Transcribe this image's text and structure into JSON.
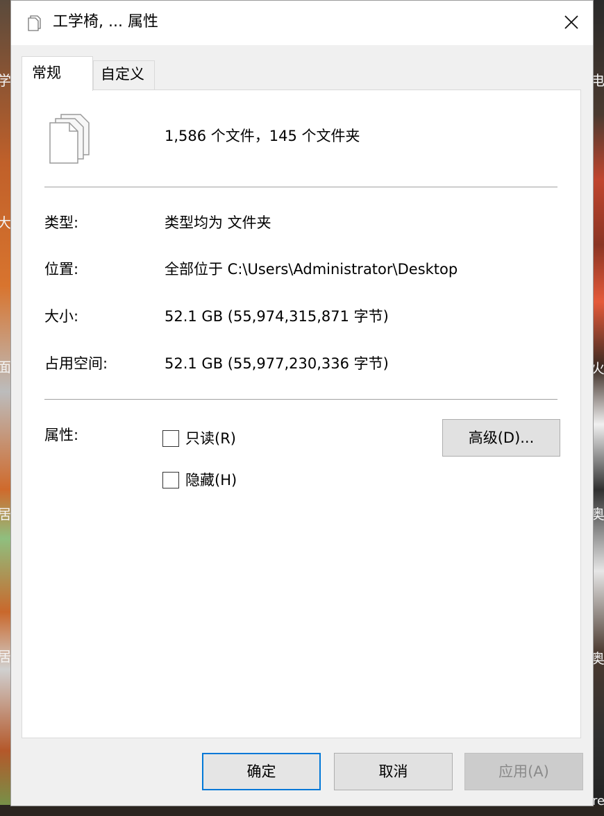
{
  "window": {
    "title": "工学椅, ... 属性",
    "close_icon": "close-icon"
  },
  "tabs": [
    {
      "label": "常规",
      "selected": true
    },
    {
      "label": "自定义",
      "selected": false
    }
  ],
  "summary": {
    "icon": "multiple-files-icon",
    "text": "1,586 个文件，145 个文件夹"
  },
  "details": {
    "type_label": "类型:",
    "type_value": "类型均为 文件夹",
    "location_label": "位置:",
    "location_value": "全部位于 C:\\Users\\Administrator\\Desktop",
    "size_label": "大小:",
    "size_value": "52.1 GB (55,974,315,871 字节)",
    "disk_label": "占用空间:",
    "disk_value": "52.1 GB (55,977,230,336 字节)"
  },
  "attributes": {
    "label": "属性:",
    "readonly_label": "只读(R)",
    "readonly_checked": false,
    "hidden_label": "隐藏(H)",
    "hidden_checked": false,
    "advanced_button": "高级(D)..."
  },
  "buttons": {
    "ok": "确定",
    "cancel": "取消",
    "apply": "应用(A)",
    "apply_enabled": false
  },
  "desktop": {
    "left_glyphs": [
      "学",
      "大",
      "面",
      "居",
      "居"
    ],
    "right_glyphs": [
      "电",
      "火",
      "奥",
      "奥",
      "re"
    ]
  },
  "colors": {
    "window_bg": "#f0f0f0",
    "focus_border": "#0078d7",
    "disabled_text": "#8a8a8a"
  }
}
